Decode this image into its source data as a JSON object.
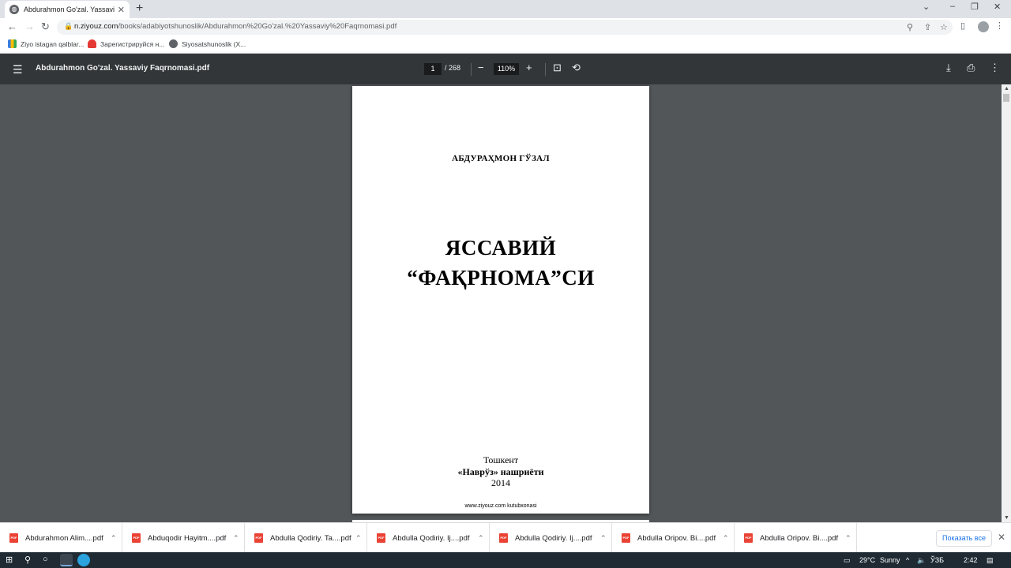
{
  "browser": {
    "tab_title": "Abdurahmon Go'zal. Yassaviy Faqrnomasi.pdf",
    "tab_close": "✕",
    "new_tab": "+",
    "window_controls": [
      "⌄",
      "–",
      "❐",
      "✕"
    ],
    "url_host": "n.ziyouz.com",
    "url_path": "/books/adabiyotshunoslik/Abdurahmon%20Go'zal.%20Yassaviy%20Faqrnomasi.pdf",
    "bookmarks": [
      {
        "label": "Ziyo istagan qalblar...",
        "color": "#3b7ddd"
      },
      {
        "label": "Зарегистрируйся н...",
        "color": "#e53935"
      },
      {
        "label": "Siyosatshunoslik (X...",
        "color": "#5f6368"
      }
    ]
  },
  "pdf_toolbar": {
    "title": "Abdurahmon Go'zal. Yassaviy Faqrnomasi.pdf",
    "current_page": "1",
    "total_pages": "/ 268",
    "zoom": "110%"
  },
  "pdf_page": {
    "author": "АБДУРАҲМОН ГЎЗАЛ",
    "title_line1": "ЯССАВИЙ",
    "title_line2": "“ФАҚРНОМА”СИ",
    "city": "Тошкент",
    "publisher": "«Наврўз» нашриёти",
    "year": "2014",
    "footer": "www.ziyouz.com kutubxonasi"
  },
  "downloads": {
    "items": [
      "Abdurahmon Alim....pdf",
      "Abduqodir Hayitm....pdf",
      "Abdulla Qodiriy. Ta....pdf",
      "Abdulla Qodiriy. Ij....pdf",
      "Abdulla Qodiriy. Ij....pdf",
      "Abdulla Oripov. Bi....pdf",
      "Abdulla Oripov. Bi....pdf"
    ],
    "show_all": "Показать все"
  },
  "taskbar": {
    "temperature": "29°C",
    "weather": "Sunny",
    "language": "ЎЗБ",
    "time": "2:42"
  }
}
